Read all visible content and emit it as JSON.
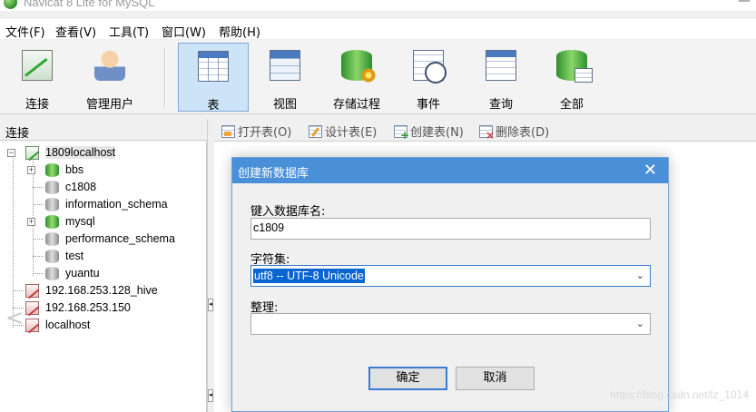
{
  "window": {
    "title": "Navicat 8 Lite for MySQL",
    "minimize": "—"
  },
  "menu": [
    "文件(F)",
    "查看(V)",
    "工具(T)",
    "窗口(W)",
    "帮助(H)"
  ],
  "toolbar": {
    "connect": "连接",
    "manage_users": "管理用户",
    "tables": "表",
    "views": "视图",
    "procedures": "存储过程",
    "events": "事件",
    "queries": "查询",
    "all": "全部"
  },
  "sidebar": {
    "header": "连接",
    "tree": {
      "root": "1809localhost",
      "databases": [
        "bbs",
        "c1808",
        "information_schema",
        "mysql",
        "performance_schema",
        "test",
        "yuantu"
      ],
      "other_connections": [
        "192.168.253.128_hive",
        "192.168.253.150",
        "localhost"
      ]
    }
  },
  "object_toolbar": {
    "open_table": "打开表(O)",
    "design_table": "设计表(E)",
    "create_table": "创建表(N)",
    "delete_table": "删除表(D)"
  },
  "dialog": {
    "title": "创建新数据库",
    "close": "✕",
    "name_label": "键入数据库名:",
    "name_value": "c1809",
    "charset_label": "字符集:",
    "charset_value": "utf8 -- UTF-8 Unicode",
    "collation_label": "整理:",
    "collation_value": "",
    "ok": "确定",
    "cancel": "取消"
  },
  "watermark": "https://blog.csdn.net/lz_1014"
}
